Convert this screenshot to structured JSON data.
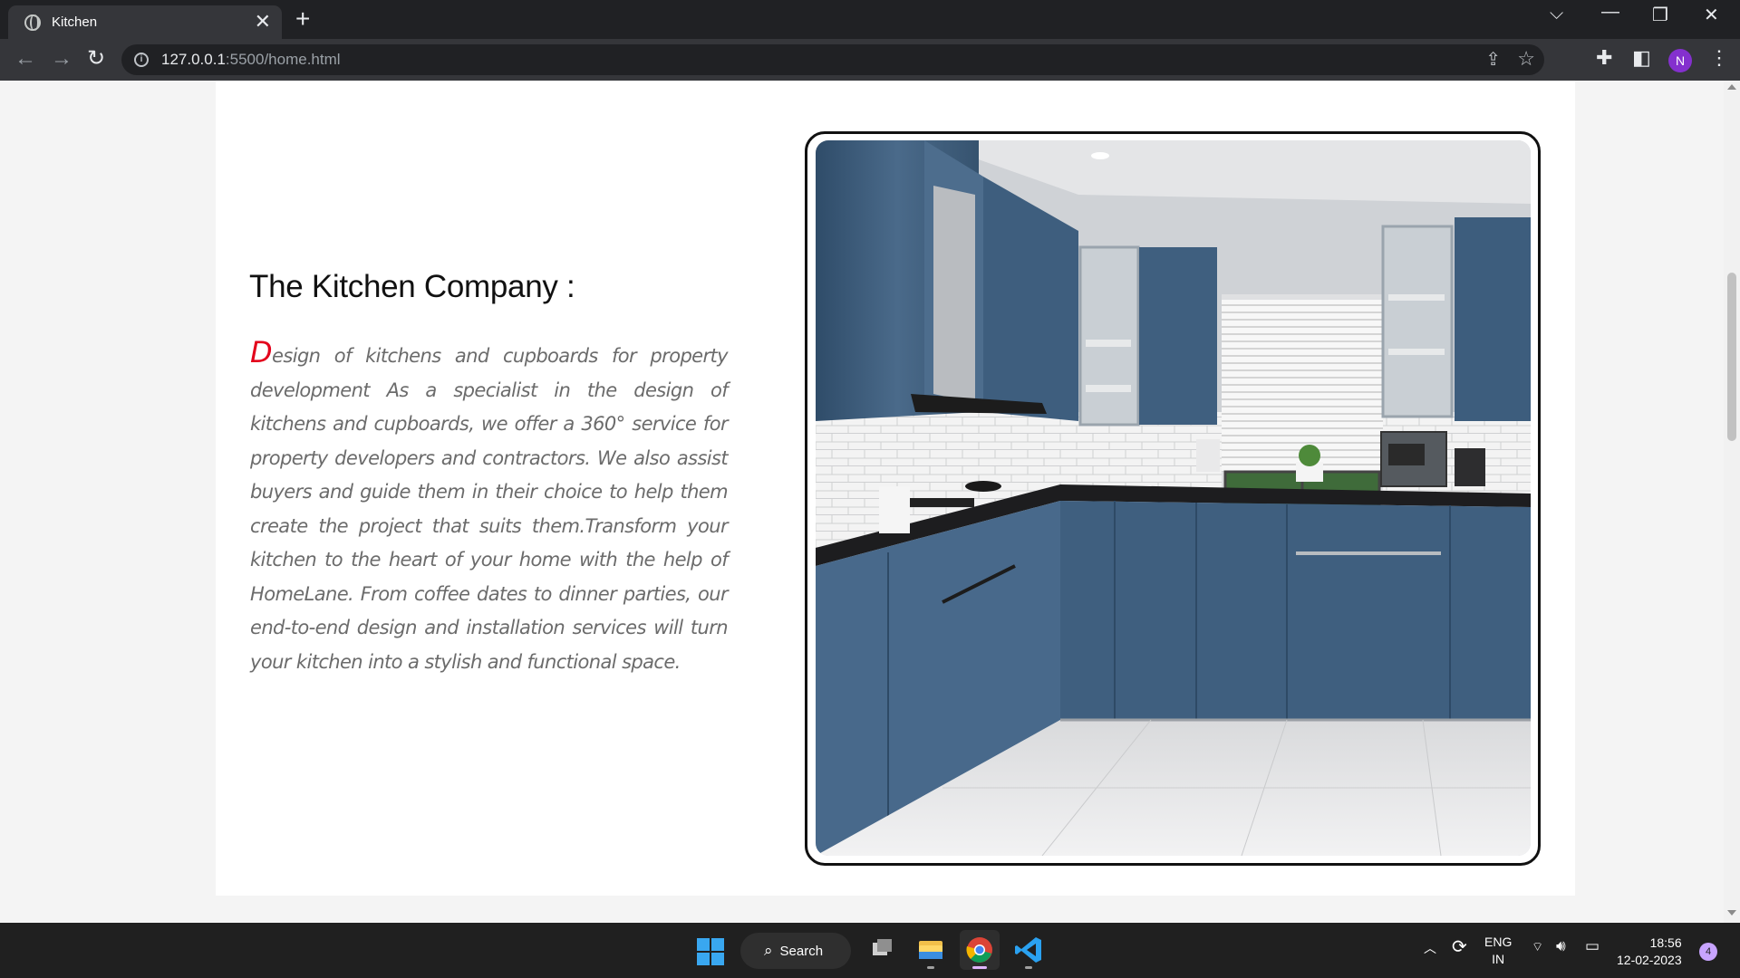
{
  "browser": {
    "tab_title": "Kitchen",
    "tab_close": "✕",
    "new_tab": "+",
    "url_host": "127.0.0.1",
    "url_rest": ":5500/home.html",
    "profile_initial": "N"
  },
  "page": {
    "heading": "The Kitchen Company :",
    "dropcap": "D",
    "paragraph": "esign of kitchens and cupboards for property development As a specialist in the design of kitchens and cupboards, we offer a 360° service for property developers and contractors. We also assist buyers and guide them in their choice to help them create the project that suits them.Transform your kitchen to the heart of your home with the help of HomeLane. From coffee dates to dinner parties, our end-to-end design and installation services will turn your kitchen into a stylish and functional space."
  },
  "taskbar": {
    "search_label": "Search",
    "lang_line1": "ENG",
    "lang_line2": "IN",
    "time": "18:56",
    "date": "12-02-2023",
    "notification_count": "4"
  },
  "colors": {
    "dropcap": "#e3001b",
    "cabinet_blue": "#3f5f7e",
    "chrome_dark": "#202124",
    "profile": "#8430ce"
  }
}
